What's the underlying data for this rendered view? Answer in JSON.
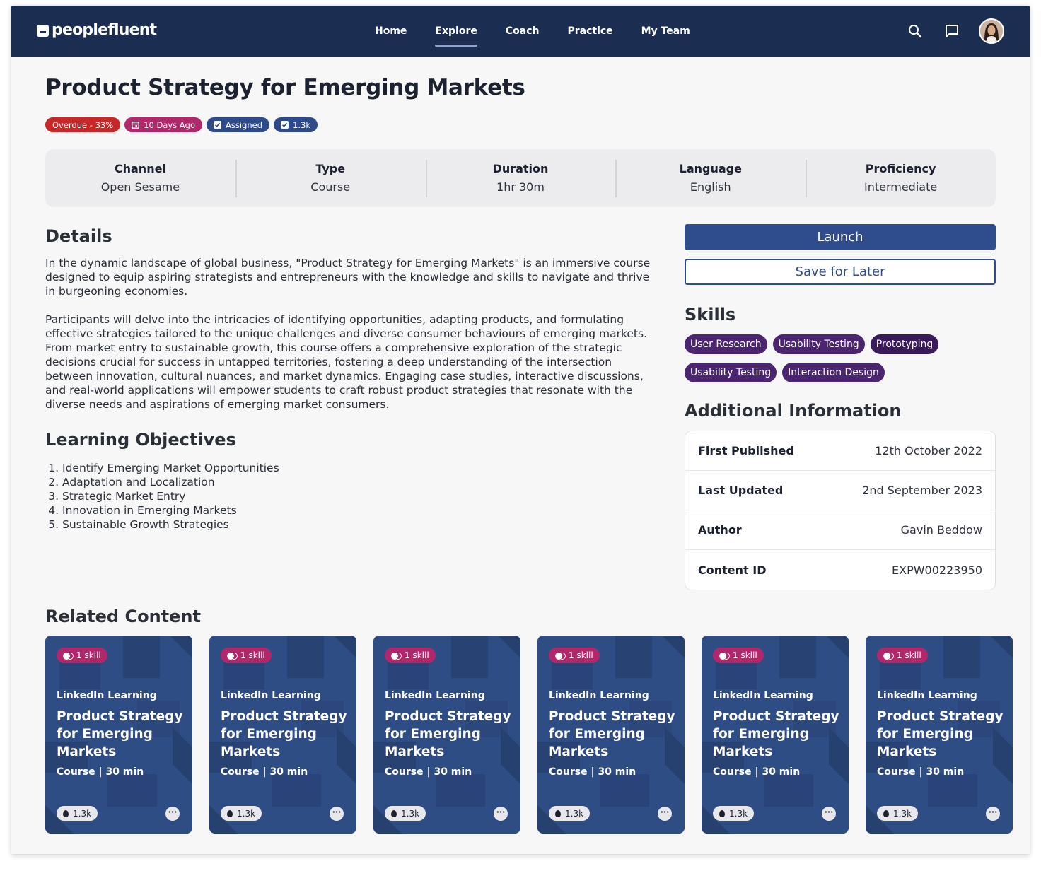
{
  "brand": {
    "name": "peoplefluent"
  },
  "nav": {
    "items": [
      {
        "label": "Home",
        "active": false
      },
      {
        "label": "Explore",
        "active": true
      },
      {
        "label": "Coach",
        "active": false
      },
      {
        "label": "Practice",
        "active": false
      },
      {
        "label": "My Team",
        "active": false
      }
    ]
  },
  "course": {
    "title": "Product Strategy for Emerging Markets",
    "badges": {
      "overdue": "Overdue - 33%",
      "date": "10 Days Ago",
      "assigned": "Assigned",
      "views": "1.3k"
    }
  },
  "meta": [
    {
      "label": "Channel",
      "value": "Open Sesame"
    },
    {
      "label": "Type",
      "value": "Course"
    },
    {
      "label": "Duration",
      "value": "1hr 30m"
    },
    {
      "label": "Language",
      "value": "English"
    },
    {
      "label": "Proficiency",
      "value": "Intermediate"
    }
  ],
  "details": {
    "heading": "Details",
    "paragraphs": [
      "In the dynamic landscape of global business, \"Product Strategy for Emerging Markets\" is an immersive course designed to equip aspiring strategists and entrepreneurs with the knowledge and skills to navigate and thrive in burgeoning economies.",
      "Participants will delve into the intricacies of identifying opportunities, adapting products, and formulating effective strategies tailored to the unique challenges and diverse consumer behaviours of emerging markets. From market entry to sustainable growth, this course offers a comprehensive exploration of the strategic decisions crucial for success in untapped territories, fostering a deep understanding of the intersection between innovation, cultural nuances, and market dynamics. Engaging case studies, interactive discussions, and real-world applications will empower students to craft robust product strategies that resonate with the diverse needs and aspirations of emerging market consumers."
    ]
  },
  "objectives": {
    "heading": "Learning Objectives",
    "items": [
      "Identify Emerging Market Opportunities",
      "Adaptation and Localization",
      "Strategic Market Entry",
      "Innovation in Emerging Markets",
      "Sustainable Growth Strategies"
    ]
  },
  "actions": {
    "launch": "Launch",
    "save": "Save for Later"
  },
  "skills": {
    "heading": "Skills",
    "items": [
      "User Research",
      "Usability Testing",
      "Prototyping",
      "Usability Testing",
      "Interaction Design"
    ]
  },
  "additional": {
    "heading": "Additional Information",
    "rows": [
      {
        "label": "First Published",
        "value": "12th October 2022"
      },
      {
        "label": "Last Updated",
        "value": "2nd September 2023"
      },
      {
        "label": "Author",
        "value": "Gavin Beddow"
      },
      {
        "label": "Content ID",
        "value": "EXPW00223950"
      }
    ]
  },
  "related": {
    "heading": "Related Content",
    "cards": [
      {
        "skill": "1 skill",
        "provider": "LinkedIn Learning",
        "title": "Product Strategy for Emerging Markets",
        "meta": "Course | 30 min",
        "views": "1.3k",
        "more": "···"
      },
      {
        "skill": "1 skill",
        "provider": "LinkedIn Learning",
        "title": "Product Strategy for Emerging Markets",
        "meta": "Course | 30 min",
        "views": "1.3k",
        "more": "···"
      },
      {
        "skill": "1 skill",
        "provider": "LinkedIn Learning",
        "title": "Product Strategy for Emerging Markets",
        "meta": "Course | 30 min",
        "views": "1.3k",
        "more": "···"
      },
      {
        "skill": "1 skill",
        "provider": "LinkedIn Learning",
        "title": "Product Strategy for Emerging Markets",
        "meta": "Course | 30 min",
        "views": "1.3k",
        "more": "···"
      },
      {
        "skill": "1 skill",
        "provider": "LinkedIn Learning",
        "title": "Product Strategy for Emerging Markets",
        "meta": "Course | 30 min",
        "views": "1.3k",
        "more": "···"
      },
      {
        "skill": "1 skill",
        "provider": "LinkedIn Learning",
        "title": "Product Strategy for Emerging Markets",
        "meta": "Course | 30 min",
        "views": "1.3k",
        "more": "···"
      }
    ]
  },
  "icons": {
    "search": "search-icon",
    "messages": "message-icon",
    "avatar": "user-avatar"
  },
  "colors": {
    "header": "#1c2d52",
    "primary": "#2f4c8d",
    "overdue": "#c62828",
    "pink": "#b0276a",
    "skill": "#4b2570",
    "card": "#2f4d85"
  }
}
